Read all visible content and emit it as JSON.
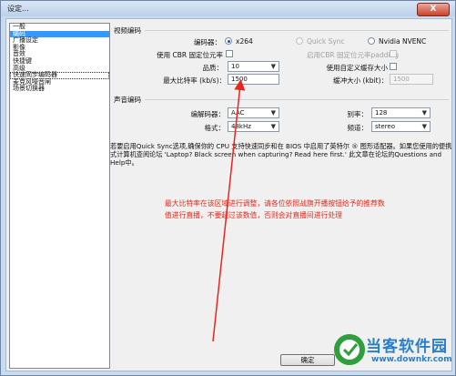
{
  "window": {
    "title": "设定...",
    "close_label": "X"
  },
  "sidebar": {
    "items": [
      "一般",
      "编码",
      "广播设定",
      "影像",
      "音效",
      "快捷键",
      "高级",
      "快速同步编码器",
      "麦克风噪音闸",
      "场景切换器"
    ],
    "selected_index": 1,
    "focused_index": 7
  },
  "video": {
    "section_title": "视频编码",
    "encoder_label": "编码器：",
    "encoders": [
      "x264",
      "Quick Sync",
      "Nvidia NVENC"
    ],
    "selected_encoder": "x264",
    "cbr_label": "使用 CBR 固定位元率",
    "cbr_padding_label": "启用CBR 固定位元率padding",
    "quality_label": "品质：",
    "quality_value": "10",
    "custom_buffer_label": "使用自定义缓存大小",
    "max_bitrate_label": "最大比特率 (kb/s)：",
    "max_bitrate_value": "1500",
    "buffer_size_label": "缓冲大小 (kbit)：",
    "buffer_size_value": "1500"
  },
  "audio": {
    "section_title": "声音编码",
    "codec_label": "编解码器：",
    "codec_value": "AAC",
    "bitrate_label": "别率：",
    "bitrate_value": "128",
    "format_label": "格式：",
    "format_value": "48kHz",
    "channel_label": "频道：",
    "channel_value": "stereo"
  },
  "info_text": "若要启用Quick Sync选项,确保你的 CPU 支持快速同步和在 BIOS 中启用了英特尔 ® 图形适配器。如果您使用的便携式计算机查阅论坛 'Laptop? Black screen when capturing? Read here first.' 此文章在论坛的Questions and Help中。",
  "annotation": {
    "text": "最大比特率在该区域进行调整，请各位依照战旗开播按钮给予的推荐数值进行直播，不要超过该数值，否则会对直播间进行处理",
    "color": "#e8261b"
  },
  "buttons": {
    "ok": "确定"
  },
  "watermark": {
    "name": "当客软件园",
    "url": "www.downkr.com"
  }
}
